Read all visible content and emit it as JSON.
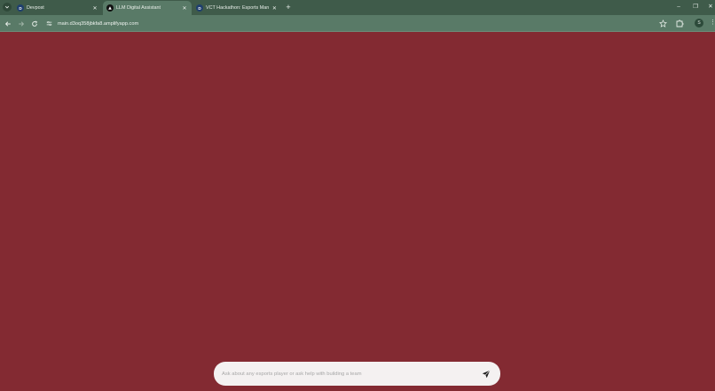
{
  "browser": {
    "tabs": [
      {
        "favicon_letter": "D",
        "title": "Devpost",
        "active": false
      },
      {
        "favicon_letter": "",
        "title": "LLM Digital Assistant",
        "active": true
      },
      {
        "favicon_letter": "D",
        "title": "VCT Hackathon: Esports Manag",
        "active": false
      }
    ],
    "new_tab_symbol": "+",
    "window_controls": {
      "minimize": "–",
      "restore": "❐",
      "close": "✕"
    },
    "address": "main.d3oq358jbkfa8.amplifyapp.com",
    "profile_initial": "S",
    "menu_symbol": "⋮"
  },
  "chat": {
    "placeholder": "Ask about any esports player or ask help with building a team",
    "value": ""
  },
  "colors": {
    "page_background": "#832a32",
    "browser_frame": "#3f5b4a",
    "toolbar": "#597a67",
    "chat_bar": "#f4f1f1"
  },
  "icons": {
    "tab_search": "chevron-down-icon",
    "back": "arrow-left-icon",
    "forward": "arrow-right-icon",
    "reload": "reload-icon",
    "site_info": "tune-icon",
    "bookmark": "star-icon",
    "extensions": "puzzle-icon",
    "send": "send-icon"
  }
}
